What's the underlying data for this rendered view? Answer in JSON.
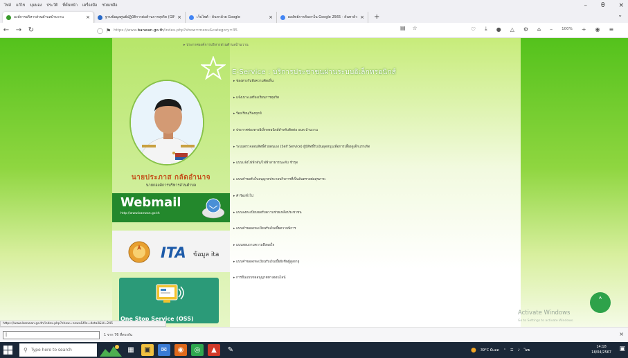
{
  "browser": {
    "menu": [
      "ไฟล์",
      "แก้ไข",
      "มุมมอง",
      "ประวัติ",
      "ที่คั่นหน้า",
      "เครื่องมือ",
      "ช่วยเหลือ"
    ],
    "window_controls": {
      "minimize": "–",
      "maximize": "θ",
      "close": "×"
    },
    "tabs": [
      {
        "title": "องค์การบริหารส่วนตำบลบ้านวาน",
        "favicon_color": "#3a9a2c",
        "active": true
      },
      {
        "title": "ฐานข้อมูลศูนย์ปฏิบัติการต่อต้านการทุจริต (GINFO*)",
        "favicon_color": "#2a6ac8",
        "active": false
      },
      {
        "title": "เว็บไซต์ - ค้นหาด้วย Google",
        "favicon_color": "#4285f4",
        "active": false
      },
      {
        "title": "ผลลัพธ์การค้นหาใน Google 2565 - ค้นหาด้วย",
        "favicon_color": "#4285f4",
        "active": false
      }
    ],
    "new_tab": "+",
    "url_prefix": "https://www.",
    "url_host": "banwan.go.th",
    "url_path": "/index.php?show=menu&category=35",
    "zoom": "100%"
  },
  "page": {
    "top_text": "▸ ประกาศองค์การบริหารส่วนตำบลบ้านวาน",
    "person": {
      "name": "นายประภาส กลัดอำนาจ",
      "title": "นายกองค์การบริหารส่วนตำบล"
    },
    "webmail": {
      "title": "Webmail",
      "url": "http://www.banwan.go.th"
    },
    "ita": {
      "logo": "ITA",
      "caption": "ข้อมูล ita"
    },
    "oss": {
      "label": "One Stop Service (OSS)"
    },
    "eservice_title": "E-Service : บริการประชาชนผ่านระบบอิเล็กทรอนิกส์",
    "menu_items": [
      "ช่องทางรับฟังความคิดเห็น",
      "แจ้งเบาะแสร้องเรียนการทุจริต",
      "ร้องเรียน/ร้องทุกข์",
      "ประกาศช่องทางอิเล็กทรอนิกส์สำหรับติดต่อ อบต.บ้านวาน",
      "ระบบตรวจสอบสิทธิ์ด้วยตนเอง (Self Service) ผู้มีสิทธิ์รับเงินอุดหนุนเพื่อการเลี้ยงดูเด็กแรกเกิด",
      "แบบแจ้งไฟฟ้าดับ/ไฟฟ้าสาธารณะดับ ชำรุด",
      "แบบคำขอรับใบอนุญาตประกอบกิจการที่เป็นอันตรายต่อสุขภาพ",
      "คำร้องทั่วไป",
      "แบบลงทะเบียนขอรับความช่วยเหลือประชาชน",
      "แบบคำขอลงทะเบียนรับเงินเบี้ยความพิการ",
      "แบบสอบถามความพึงพอใจ",
      "แบบคำขอลงทะเบียนรับเงินเบี้ยยังชีพผู้สูงอายุ",
      "การยื่นแบบขออนุญาตทางออนไลน์"
    ],
    "activate_windows": "Activate Windows",
    "activate_sub": "Go to Settings to activate Windows.",
    "scroll_top": "˄"
  },
  "status_link": "https://www.banwan.go.th/index.php?show=news&file=detail&id=245",
  "find_bar": {
    "value": "|",
    "count": "1 จาก 76 ที่ตรงกัน"
  },
  "taskbar": {
    "search_placeholder": "Type here to search",
    "weather": "39°C มีแดด",
    "time": "14:18",
    "date": "18/04/2567"
  }
}
